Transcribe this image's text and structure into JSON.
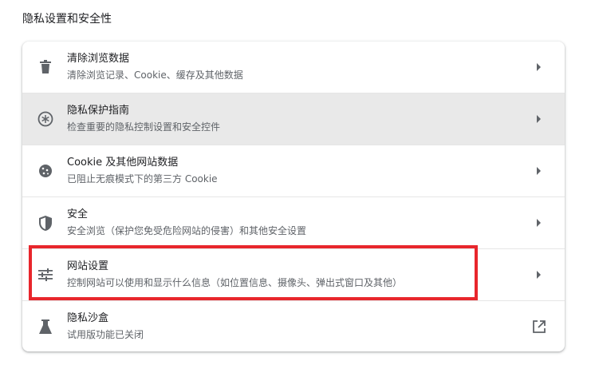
{
  "section": {
    "title": "隐私设置和安全性"
  },
  "rows": [
    {
      "title": "清除浏览数据",
      "desc": "清除浏览记录、Cookie、缓存及其他数据",
      "icon": "trash-icon",
      "trail": "arrow-right-icon"
    },
    {
      "title": "隐私保护指南",
      "desc": "检查重要的隐私控制设置和安全控件",
      "icon": "privacy-guide-icon",
      "trail": "arrow-right-icon"
    },
    {
      "title": "Cookie 及其他网站数据",
      "desc": "已阻止无痕模式下的第三方 Cookie",
      "icon": "cookie-icon",
      "trail": "arrow-right-icon"
    },
    {
      "title": "安全",
      "desc": "安全浏览（保护您免受危险网站的侵害）和其他安全设置",
      "icon": "shield-icon",
      "trail": "arrow-right-icon"
    },
    {
      "title": "网站设置",
      "desc": "控制网站可以使用和显示什么信息（如位置信息、摄像头、弹出式窗口及其他）",
      "icon": "sliders-icon",
      "trail": "arrow-right-icon"
    },
    {
      "title": "隐私沙盒",
      "desc": "试用版功能已关闭",
      "icon": "flask-icon",
      "trail": "open-in-new-icon"
    }
  ],
  "colors": {
    "highlight": "#e8262c",
    "hover_row": "#e9e9e9",
    "icon": "#5f6368"
  }
}
